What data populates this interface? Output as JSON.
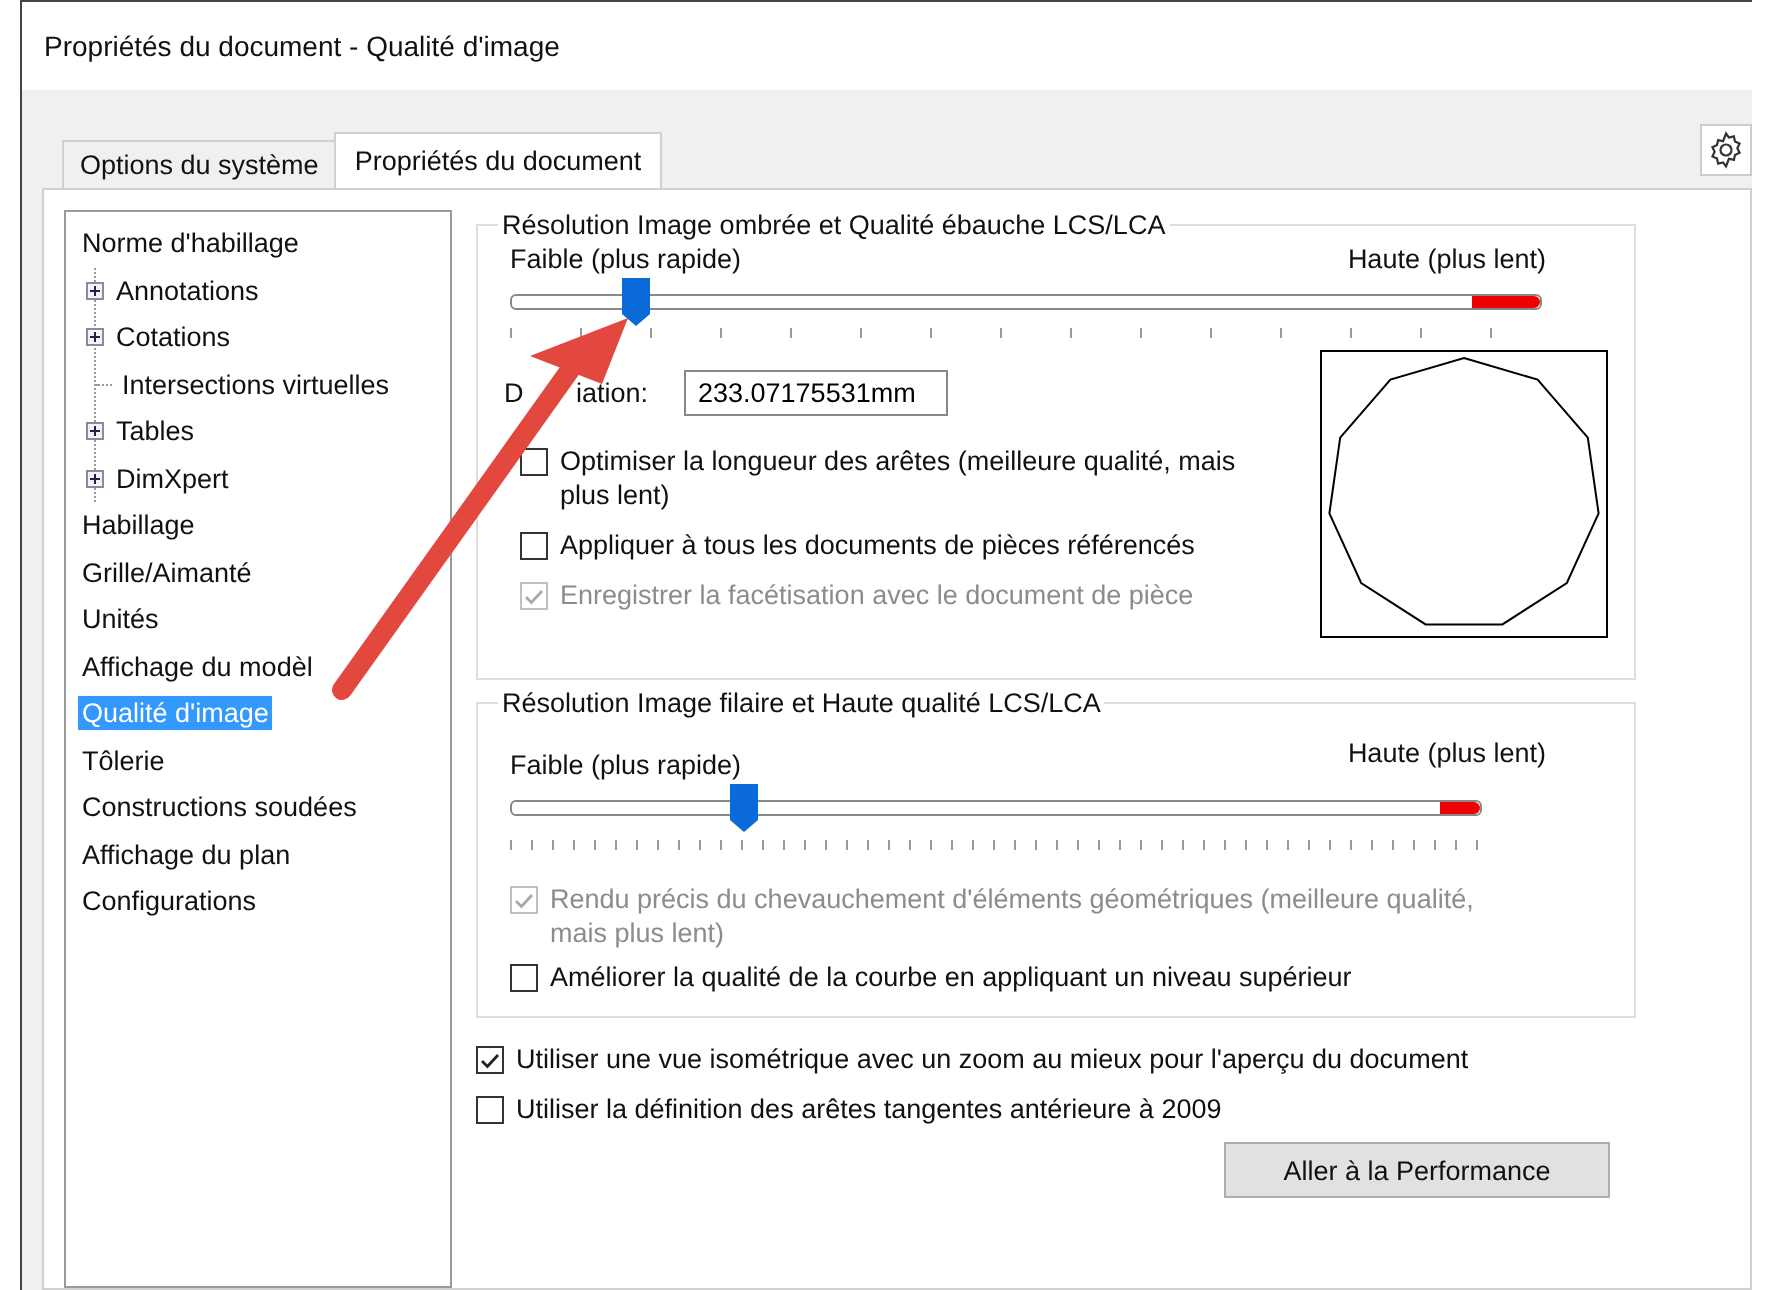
{
  "window": {
    "title": "Propriétés du document - Qualité d'image"
  },
  "tabs": [
    {
      "label": "Options du système",
      "selected": false
    },
    {
      "label": "Propriétés du document",
      "selected": true
    }
  ],
  "tree": [
    {
      "label": "Norme d'habillage",
      "selected": false,
      "children": [
        {
          "label": "Annotations",
          "kind": "collapsed",
          "selected": false
        },
        {
          "label": "Cotations",
          "kind": "collapsed",
          "selected": false
        },
        {
          "label": "Intersections virtuelles",
          "kind": "leaf",
          "selected": false
        },
        {
          "label": "Tables",
          "kind": "collapsed",
          "selected": false
        },
        {
          "label": "DimXpert",
          "kind": "collapsed",
          "selected": false
        }
      ]
    },
    {
      "label": "Habillage",
      "selected": false
    },
    {
      "label": "Grille/Aimanté",
      "selected": false
    },
    {
      "label": "Unités",
      "selected": false
    },
    {
      "label": "Affichage du modèl",
      "selected": false
    },
    {
      "label": "Qualité d'image",
      "selected": true
    },
    {
      "label": "Tôlerie",
      "selected": false
    },
    {
      "label": "Constructions soudées",
      "selected": false
    },
    {
      "label": "Affichage du plan",
      "selected": false
    },
    {
      "label": "Configurations",
      "selected": false
    }
  ],
  "shaded": {
    "legend": "Résolution Image ombrée et Qualité ébauche LCS/LCA",
    "slider": {
      "low_label": "Faible (plus rapide)",
      "high_label": "Haute (plus lent)",
      "level": 0.12
    },
    "deviation": {
      "label_start": "D",
      "label_end": "iation:",
      "value": "233.07175531mm"
    },
    "checkboxes": [
      {
        "label": "Optimiser la longueur des arêtes (meilleure qualité, mais plus lent)",
        "checked": false,
        "disabled": false
      },
      {
        "label": "Appliquer à tous les documents de pièces référencés",
        "checked": false,
        "disabled": false
      },
      {
        "label": "Enregistrer la facétisation avec le document de pièce",
        "checked": true,
        "disabled": true
      }
    ]
  },
  "wireframe": {
    "legend": "Résolution Image filaire et Haute qualité LCS/LCA",
    "slider": {
      "low_label": "Faible (plus rapide)",
      "high_label": "Haute (plus lent)",
      "level": 0.24
    },
    "checkboxes": [
      {
        "label": "Rendu précis du chevauchement d'éléments géométriques (meilleure qualité, mais plus lent)",
        "checked": true,
        "disabled": true
      },
      {
        "label": "Améliorer la qualité de la courbe en appliquant un niveau supérieur",
        "checked": false,
        "disabled": false
      }
    ]
  },
  "options": [
    {
      "label": "Utiliser une vue isométrique avec un zoom au mieux pour l'aperçu du document",
      "checked": true,
      "disabled": false
    },
    {
      "label": "Utiliser la définition des arêtes tangentes antérieure à 2009",
      "checked": false,
      "disabled": false
    }
  ],
  "button": "Aller à la Performance"
}
